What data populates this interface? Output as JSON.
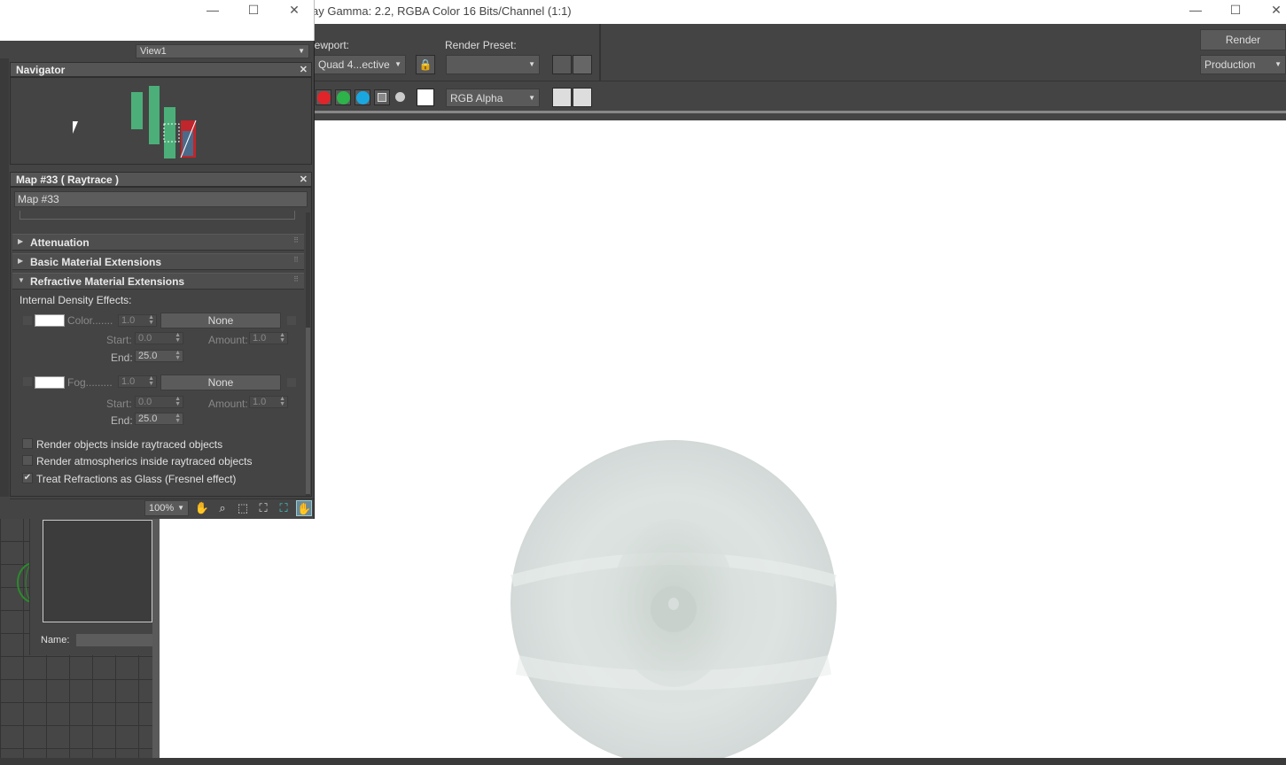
{
  "frame_window": {
    "title": "ay Gamma: 2.2, RGBA Color 16 Bits/Channel (1:1)",
    "viewport_label": "iewport:",
    "viewport_value": "Quad 4...ective",
    "render_preset_label": "Render Preset:",
    "render_preset_value": "",
    "render_button": "Render",
    "production_value": "Production",
    "channel_value": "RGB Alpha"
  },
  "editor_window": {
    "view_select": "View1",
    "navigator_title": "Navigator",
    "map_panel_title": "Map #33  ( Raytrace )",
    "map_name": "Map #33",
    "rollouts": [
      "Attenuation",
      "Basic Material Extensions",
      "Refractive Material Extensions"
    ],
    "internal_density_label": "Internal Density Effects:",
    "color_row": {
      "label": "Color.......",
      "amount": "1.0",
      "map_button": "None",
      "start_label": "Start:",
      "start": "0.0",
      "amount_label": "Amount:",
      "amount2": "1.0",
      "end_label": "End:",
      "end": "25.0"
    },
    "fog_row": {
      "label": "Fog.........",
      "amount": "1.0",
      "map_button": "None",
      "start_label": "Start:",
      "start": "0.0",
      "amount_label": "Amount:",
      "amount2": "1.0",
      "end_label": "End:",
      "end": "25.0"
    },
    "options": [
      {
        "label": "Render objects inside raytraced objects",
        "checked": false
      },
      {
        "label": "Render atmospherics inside raytraced objects",
        "checked": false
      },
      {
        "label": "Treat Refractions as Glass (Fresnel effect)",
        "checked": true
      }
    ],
    "zoom": "100%",
    "name_label": "Name:"
  },
  "colors": {
    "accent_green": "#4caf7a",
    "red_node": "#c0262b",
    "panel_bg": "#444444"
  },
  "icons": [
    "minimize-icon",
    "maximize-icon",
    "close-icon",
    "lock-icon",
    "pan-icon",
    "zoom-icon"
  ]
}
